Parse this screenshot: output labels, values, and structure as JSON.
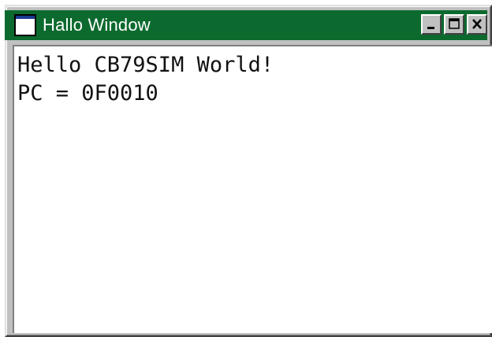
{
  "window": {
    "title": "Hallo Window",
    "titlebar_color": "#0c6a2e",
    "icons": {
      "app": "window-icon",
      "minimize": "minimize-icon",
      "maximize": "maximize-icon",
      "close": "close-icon"
    }
  },
  "content": {
    "lines": [
      "Hello CB79SIM World!",
      "PC = 0F0010"
    ]
  }
}
